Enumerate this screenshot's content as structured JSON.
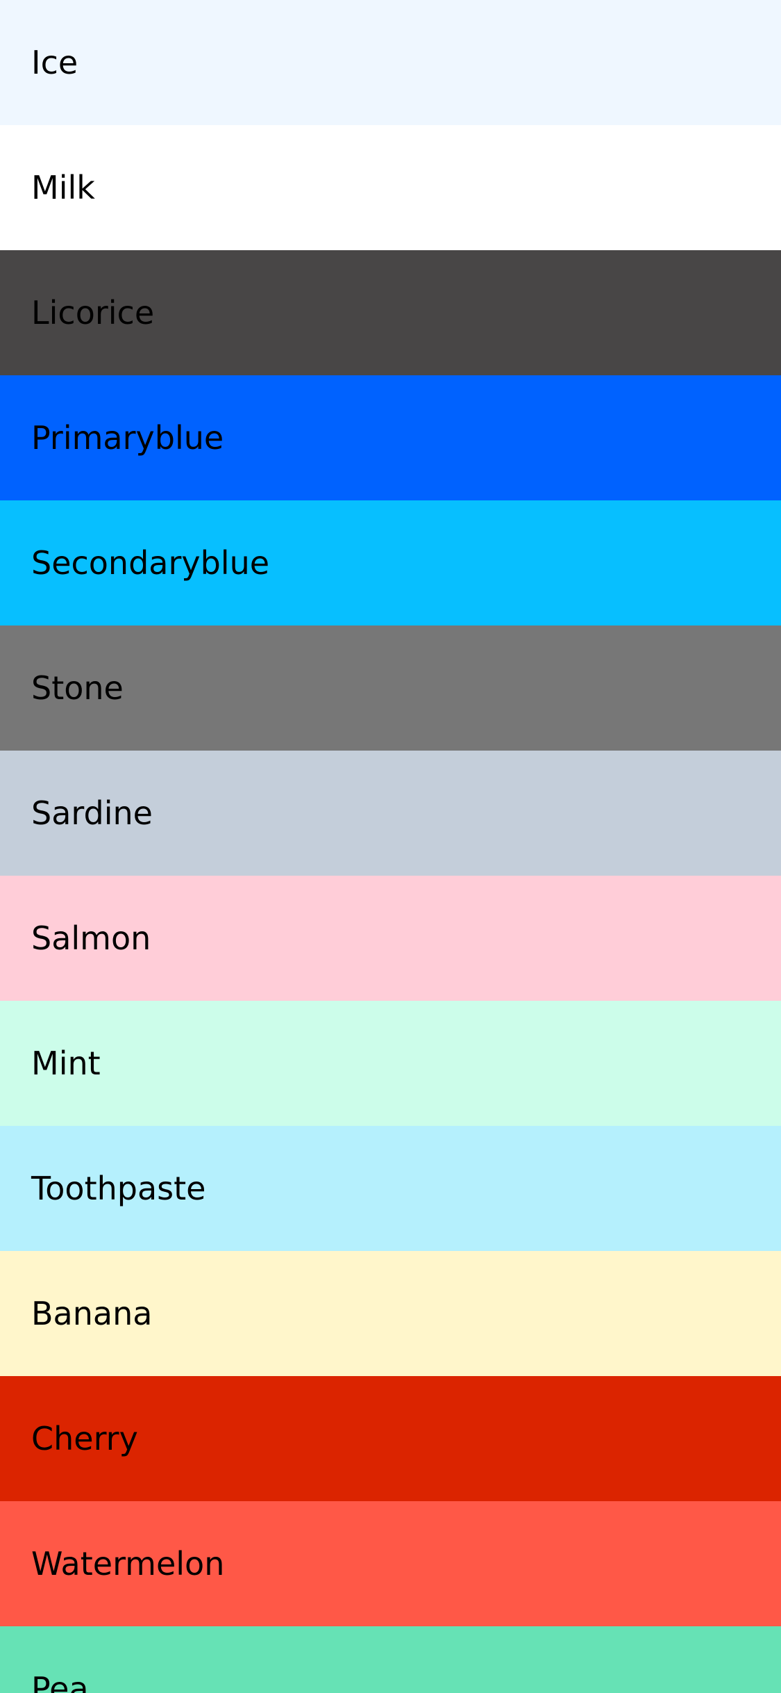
{
  "swatches": [
    {
      "name": "Ice",
      "color": "#EFF7FF"
    },
    {
      "name": "Milk",
      "color": "#FFFFFF"
    },
    {
      "name": "Licorice",
      "color": "#484646"
    },
    {
      "name": "Primaryblue",
      "color": "#0062FF"
    },
    {
      "name": "Secondaryblue",
      "color": "#07BFFF"
    },
    {
      "name": "Stone",
      "color": "#777777"
    },
    {
      "name": "Sardine",
      "color": "#C4CEDA"
    },
    {
      "name": "Salmon",
      "color": "#FFCDD8"
    },
    {
      "name": "Mint",
      "color": "#CCFDEA"
    },
    {
      "name": "Toothpaste",
      "color": "#B5F0FD"
    },
    {
      "name": "Banana",
      "color": "#FFF6CB"
    },
    {
      "name": "Cherry",
      "color": "#DB2400"
    },
    {
      "name": "Watermelon",
      "color": "#FF5847"
    },
    {
      "name": "Pea",
      "color": "#66E2B5"
    }
  ]
}
